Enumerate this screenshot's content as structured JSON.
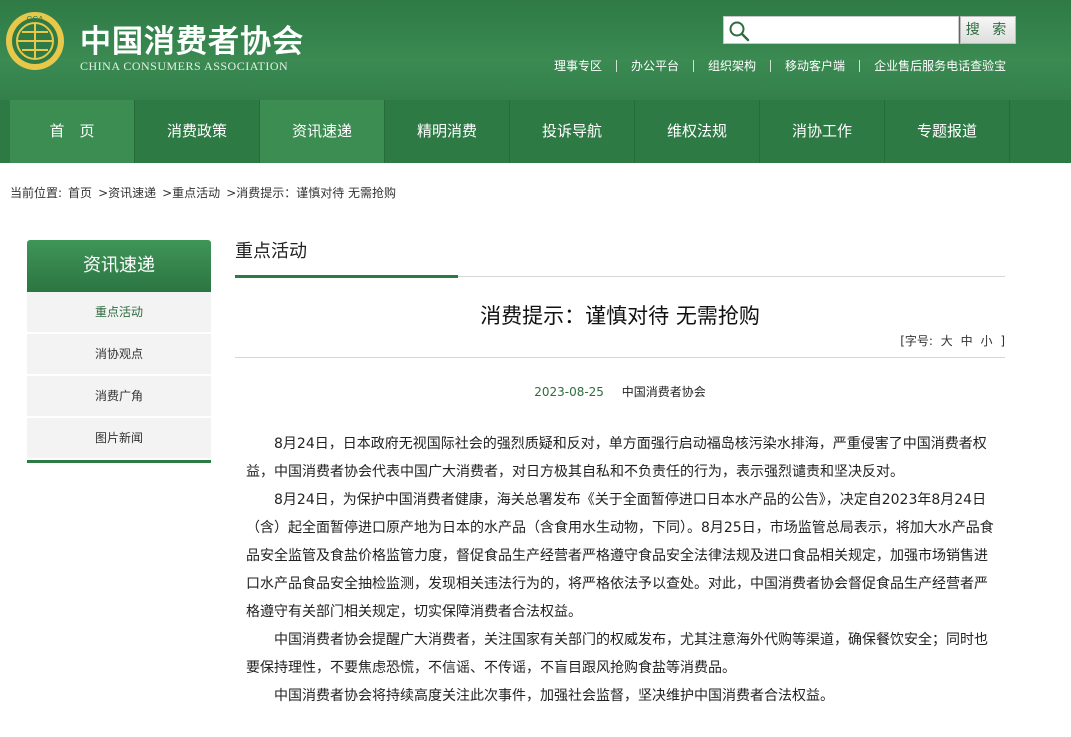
{
  "header": {
    "logo_cn": "中国消费者协会",
    "logo_en": "CHINA CONSUMERS ASSOCIATION",
    "search_placeholder": "",
    "search_button": "搜 索",
    "top_links": [
      "理事专区",
      "办公平台",
      "组织架构",
      "移动客户端",
      "企业售后服务电话查验宝"
    ],
    "brand_color": "#2e7a44"
  },
  "nav": {
    "items": [
      "首　页",
      "消费政策",
      "资讯速递",
      "精明消费",
      "投诉导航",
      "维权法规",
      "消协工作",
      "专题报道"
    ]
  },
  "breadcrumb": {
    "label": "当前位置:",
    "items": [
      "首页",
      ">资讯速递",
      ">重点活动",
      ">消费提示：谨慎对待 无需抢购"
    ]
  },
  "sidebar": {
    "title": "资讯速递",
    "items": [
      "重点活动",
      "消协观点",
      "消费广角",
      "图片新闻"
    ]
  },
  "main": {
    "section_title": "重点活动",
    "article_title": "消费提示：谨慎对待 无需抢购",
    "font_size": {
      "prefix": "[字号:",
      "large": "大",
      "medium": "中",
      "small": "小",
      "suffix": "]"
    },
    "date": "2023-08-25",
    "source": "中国消费者协会",
    "paragraphs": [
      "8月24日，日本政府无视国际社会的强烈质疑和反对，单方面强行启动福岛核污染水排海，严重侵害了中国消费者权益，中国消费者协会代表中国广大消费者，对日方极其自私和不负责任的行为，表示强烈谴责和坚决反对。",
      "8月24日，为保护中国消费者健康，海关总署发布《关于全面暂停进口日本水产品的公告》，决定自2023年8月24日（含）起全面暂停进口原产地为日本的水产品（含食用水生动物，下同）。8月25日，市场监管总局表示，将加大水产品食品安全监管及食盐价格监管力度，督促食品生产经营者严格遵守食品安全法律法规及进口食品相关规定，加强市场销售进口水产品食品安全抽检监测，发现相关违法行为的，将严格依法予以查处。对此，中国消费者协会督促食品生产经营者严格遵守有关部门相关规定，切实保障消费者合法权益。",
      "中国消费者协会提醒广大消费者，关注国家有关部门的权威发布，尤其注意海外代购等渠道，确保餐饮安全；同时也要保持理性，不要焦虑恐慌，不信谣、不传谣，不盲目跟风抢购食盐等消费品。",
      "中国消费者协会将持续高度关注此次事件，加强社会监督，坚决维护中国消费者合法权益。"
    ]
  }
}
